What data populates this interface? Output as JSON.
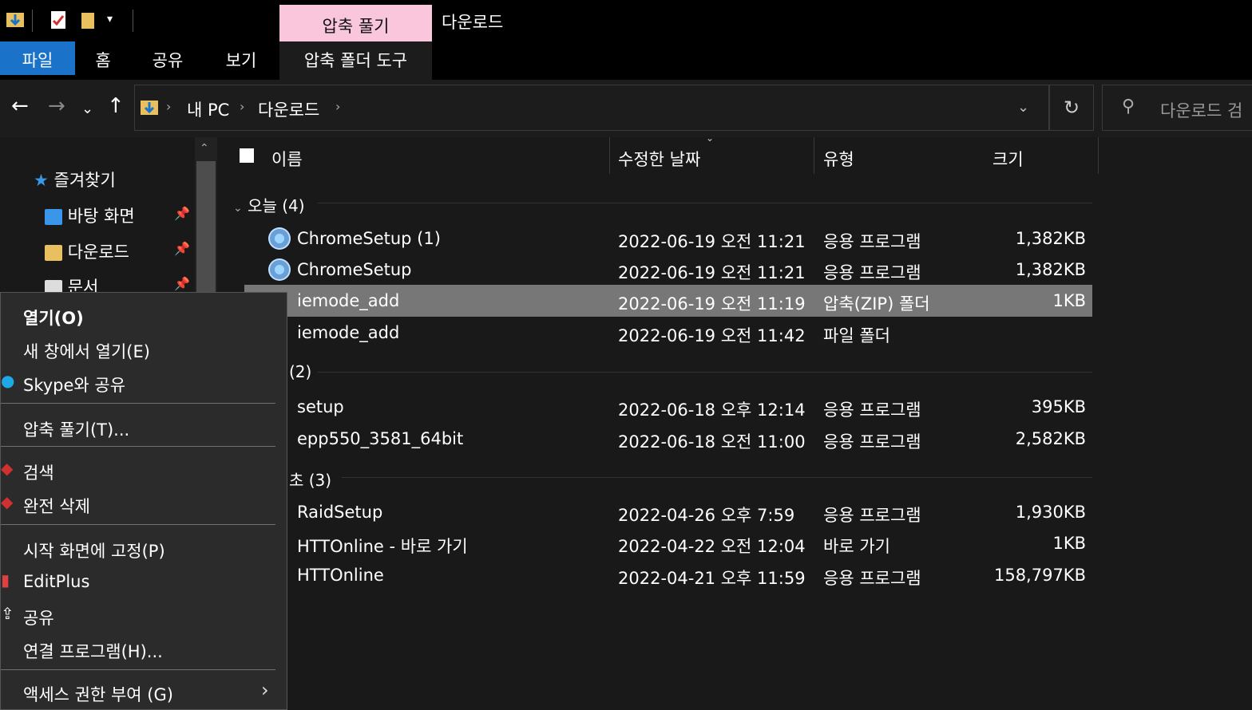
{
  "window": {
    "title": "다운로드",
    "context_tab_header": "압축 풀기"
  },
  "ribbon": {
    "tabs": [
      "파일",
      "홈",
      "공유",
      "보기",
      "압축 폴더 도구"
    ]
  },
  "address": {
    "crumbs": [
      "내 PC",
      "다운로드"
    ],
    "search_placeholder": "다운로드 검"
  },
  "nav_pane": {
    "quick_access_label": "즐겨찾기",
    "items": [
      "바탕 화면",
      "다운로드",
      "문서"
    ]
  },
  "columns": {
    "name": "이름",
    "date": "수정한 날짜",
    "type": "유형",
    "size": "크기"
  },
  "groups": [
    {
      "label": "오늘 (4)",
      "files": [
        {
          "name": "ChromeSetup (1)",
          "date": "2022-06-19 오전 11:21",
          "type": "응용 프로그램",
          "size": "1,382KB"
        },
        {
          "name": "ChromeSetup",
          "date": "2022-06-19 오전 11:21",
          "type": "응용 프로그램",
          "size": "1,382KB"
        },
        {
          "name": "iemode_add",
          "date": "2022-06-19 오전 11:19",
          "type": "압축(ZIP) 폴더",
          "size": "1KB",
          "selected": true
        },
        {
          "name": "iemode_add",
          "date": "2022-06-19 오전 11:42",
          "type": "파일 폴더",
          "size": ""
        }
      ]
    },
    {
      "label": "(2)",
      "files": [
        {
          "name": "setup",
          "date": "2022-06-18 오후 12:14",
          "type": "응용 프로그램",
          "size": "395KB"
        },
        {
          "name": "epp550_3581_64bit",
          "date": "2022-06-18 오전 11:00",
          "type": "응용 프로그램",
          "size": "2,582KB"
        }
      ]
    },
    {
      "label": "초 (3)",
      "files": [
        {
          "name": "RaidSetup",
          "date": "2022-04-26 오후 7:59",
          "type": "응용 프로그램",
          "size": "1,930KB"
        },
        {
          "name": "HTTOnline - 바로 가기",
          "date": "2022-04-22 오전 12:04",
          "type": "바로 가기",
          "size": "1KB"
        },
        {
          "name": "HTTOnline",
          "date": "2022-04-21 오후 11:59",
          "type": "응용 프로그램",
          "size": "158,797KB"
        }
      ]
    }
  ],
  "context_menu": {
    "items": [
      "열기(O)",
      "새 창에서 열기(E)",
      "Skype와 공유",
      "압축 풀기(T)...",
      "검색",
      "완전 삭제",
      "시작 화면에 고정(P)",
      "EditPlus",
      "공유",
      "연결 프로그램(H)...",
      "액세스 권한 부여 (G)"
    ]
  },
  "colors": {
    "file_tab": "#1a73c8",
    "context_tab_header": "#f9c6dc",
    "selected_row": "#777777"
  }
}
